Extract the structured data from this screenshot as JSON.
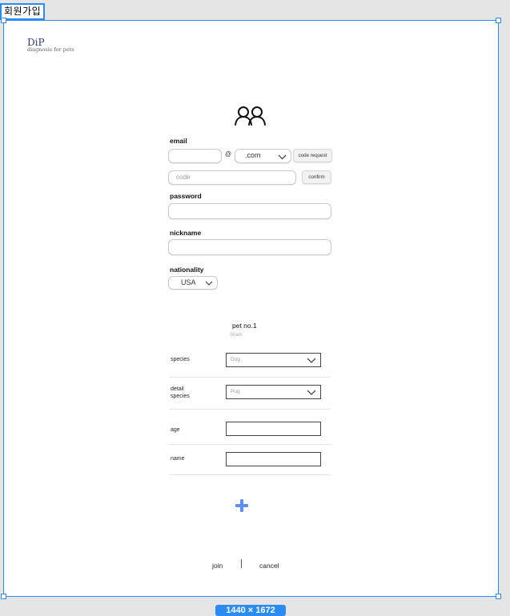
{
  "frame_tag": "회원가입",
  "size_badge": "1440 × 1672",
  "logo": {
    "title": "DiP",
    "subtitle": "diagnosis for pets"
  },
  "form": {
    "email_label": "email",
    "at_sign": "@",
    "domain_value": ".com",
    "code_request_label": "code request",
    "code_placeholder": "code",
    "confirm_label": "confirm",
    "password_label": "password",
    "nickname_label": "nickname",
    "nationality_label": "nationality",
    "nationality_value": "USA"
  },
  "pet": {
    "title": "pet no.1",
    "subtitle": "Sham",
    "species_label": "species",
    "species_value": "Dog",
    "detail_species_label_1": "detail",
    "detail_species_label_2": "species",
    "detail_species_value": "Pug",
    "age_label": "age",
    "name_label": "name"
  },
  "footer": {
    "join_label": "join",
    "cancel_label": "cancel"
  },
  "colors": {
    "selection": "#2a8cf0",
    "plus": "#5b8ff0",
    "logo": "#2b3a73"
  },
  "icons": {
    "users": "users-icon",
    "plus": "plus-icon",
    "chevron": "chevron-down-icon"
  }
}
